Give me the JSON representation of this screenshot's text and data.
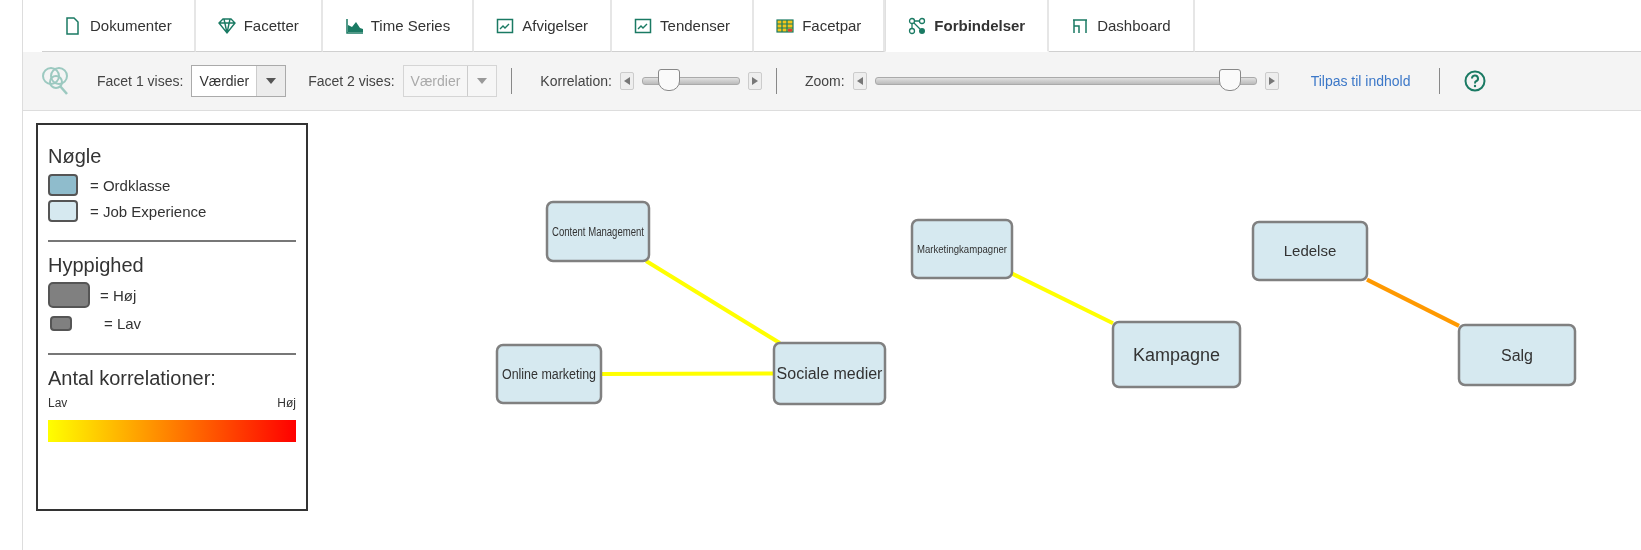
{
  "tabs": [
    {
      "label": "Dokumenter",
      "selected": false
    },
    {
      "label": "Facetter",
      "selected": false
    },
    {
      "label": "Time Series",
      "selected": false
    },
    {
      "label": "Afvigelser",
      "selected": false
    },
    {
      "label": "Tendenser",
      "selected": false
    },
    {
      "label": "Facetpar",
      "selected": false
    },
    {
      "label": "Forbindelser",
      "selected": true
    },
    {
      "label": "Dashboard",
      "selected": false
    }
  ],
  "toolbar": {
    "facet1": {
      "label": "Facet 1 vises:",
      "value": "Værdier",
      "disabled": false
    },
    "facet2": {
      "label": "Facet 2 vises:",
      "value": "Værdier",
      "disabled": true
    },
    "correlation": {
      "label": "Korrelation:",
      "level": 0.2
    },
    "zoom": {
      "label": "Zoom:",
      "level": 0.96
    },
    "fit_link": "Tilpas til indhold"
  },
  "legend": {
    "key_title": "Nøgle",
    "key_items": [
      {
        "label": "= Ordklasse",
        "color": "#8fbccc"
      },
      {
        "label": "= Job Experience",
        "color": "#d6e9f0"
      }
    ],
    "frequency_title": "Hyppighed",
    "frequency_items": [
      {
        "label": "= Høj",
        "kind": "large"
      },
      {
        "label": "= Lav",
        "kind": "small"
      }
    ],
    "count_title": "Antal korrelationer:",
    "count_low": "Lav",
    "count_high": "Høj"
  },
  "graph": {
    "nodes": [
      {
        "label": "Content Management",
        "kind": "job_experience"
      },
      {
        "label": "Online marketing",
        "kind": "job_experience"
      },
      {
        "label": "Sociale medier",
        "kind": "job_experience"
      },
      {
        "label": "Marketingkampagner",
        "kind": "job_experience"
      },
      {
        "label": "Kampagne",
        "kind": "job_experience"
      },
      {
        "label": "Ledelse",
        "kind": "job_experience"
      },
      {
        "label": "Salg",
        "kind": "job_experience"
      }
    ],
    "edges": [
      {
        "color": "#ffff00"
      },
      {
        "color": "#ffff00"
      },
      {
        "color": "#ffff00"
      },
      {
        "color": "#ff9900"
      }
    ]
  }
}
